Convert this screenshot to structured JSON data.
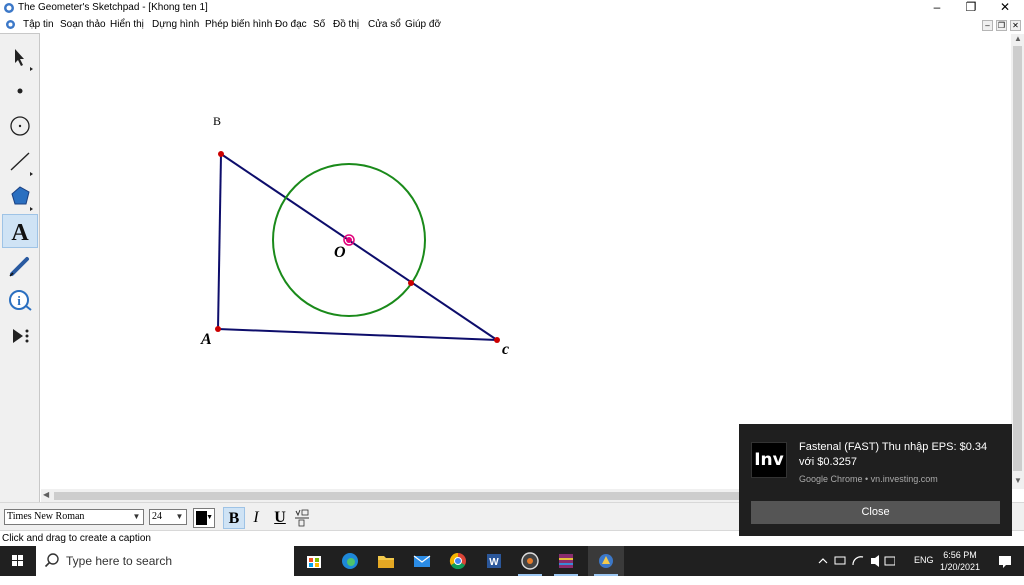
{
  "window": {
    "title": "The Geometer's Sketchpad - [Khong ten 1]",
    "controls": {
      "minimize": "–",
      "restore": "❐",
      "close": "✕"
    }
  },
  "menu": {
    "items": [
      "Tập tin",
      "Soạn thảo",
      "Hiển thị",
      "Dựng hình",
      "Phép biến hình",
      "Đo đạc",
      "Số",
      "Đồ thị",
      "Cửa sổ",
      "Giúp đỡ"
    ],
    "doc_controls": {
      "minimize": "–",
      "restore": "❐",
      "close": "✕"
    }
  },
  "toolbox": {
    "tools": [
      {
        "name": "arrow-tool-icon",
        "active": false
      },
      {
        "name": "point-tool-icon",
        "active": false
      },
      {
        "name": "compass-tool-icon",
        "active": false
      },
      {
        "name": "straightedge-tool-icon",
        "active": false
      },
      {
        "name": "polygon-tool-icon",
        "active": false
      },
      {
        "name": "text-tool-icon",
        "active": true
      },
      {
        "name": "marker-tool-icon",
        "active": false
      },
      {
        "name": "information-tool-icon",
        "active": false
      },
      {
        "name": "custom-tool-icon",
        "active": false
      }
    ],
    "text_tool_glyph": "A"
  },
  "sketch": {
    "labels": {
      "a": "A",
      "b": "B",
      "c": "c",
      "o": "O"
    },
    "colors": {
      "triangle": "#0d0d6b",
      "circle": "#1a8a1a",
      "point": "#cc0000",
      "center": "#e0007a"
    }
  },
  "text_toolbar": {
    "font": "Times New Roman",
    "size": "24",
    "bold": "B",
    "italic": "I",
    "underline": "U",
    "math_format_icon": "math-format-icon",
    "bold_active": true
  },
  "status": {
    "text": "Click and drag to create a caption"
  },
  "taskbar": {
    "search_placeholder": "Type here to search",
    "apps": [
      "store-icon",
      "edge-icon",
      "file-explorer-icon",
      "mail-icon",
      "chrome-icon",
      "word-icon",
      "media-player-icon",
      "winrar-icon",
      "sketchpad-icon"
    ],
    "tray": {
      "language": "ENG"
    },
    "clock": {
      "time": "6:56 PM",
      "date": "1/20/2021"
    }
  },
  "notification": {
    "logo": "Inv",
    "title": "Fastenal (FAST) Thu nhập EPS: $0.34 với $0.3257",
    "source": "Google Chrome • vn.investing.com",
    "close_label": "Close"
  }
}
